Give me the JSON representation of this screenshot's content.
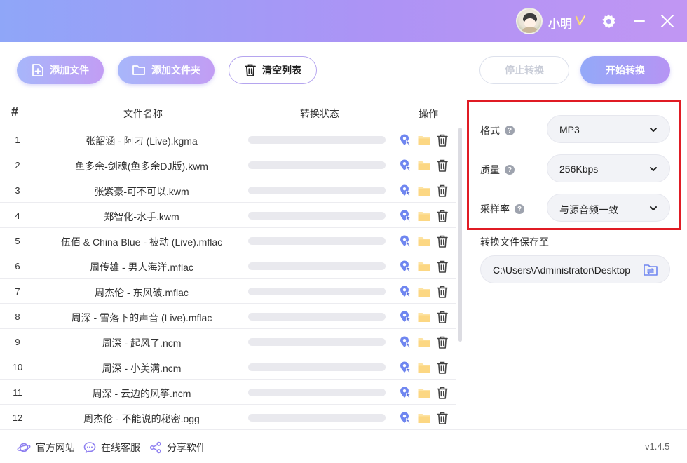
{
  "header": {
    "username": "小明",
    "vip_badge": "V",
    "icons": {
      "settings": "gear-icon",
      "minimize": "minimize-icon",
      "close": "close-icon"
    }
  },
  "toolbar": {
    "add_file": "添加文件",
    "add_folder": "添加文件夹",
    "clear_list": "清空列表",
    "stop_convert": "停止转换",
    "start_convert": "开始转换"
  },
  "table": {
    "columns": {
      "num": "#",
      "name": "文件名称",
      "status": "转换状态",
      "actions": "操作"
    },
    "rows": [
      {
        "num": "1",
        "name": "张韶涵 - 阿刁 (Live).kgma",
        "progress": 0
      },
      {
        "num": "2",
        "name": "鱼多余-剑魂(鱼多余DJ版).kwm",
        "progress": 0
      },
      {
        "num": "3",
        "name": "张紫豪-可不可以.kwm",
        "progress": 0
      },
      {
        "num": "4",
        "name": "郑智化-水手.kwm",
        "progress": 0
      },
      {
        "num": "5",
        "name": "伍佰 & China Blue - 被动 (Live).mflac",
        "progress": 0
      },
      {
        "num": "6",
        "name": "周传雄 - 男人海洋.mflac",
        "progress": 0
      },
      {
        "num": "7",
        "name": "周杰伦 - 东风破.mflac",
        "progress": 0
      },
      {
        "num": "8",
        "name": "周深 - 雪落下的声音 (Live).mflac",
        "progress": 0
      },
      {
        "num": "9",
        "name": "周深 - 起风了.ncm",
        "progress": 0
      },
      {
        "num": "10",
        "name": "周深 - 小美满.ncm",
        "progress": 0
      },
      {
        "num": "11",
        "name": "周深 - 云边的风筝.ncm",
        "progress": 0
      },
      {
        "num": "12",
        "name": "周杰伦 - 不能说的秘密.ogg",
        "progress": 0
      }
    ]
  },
  "settings": {
    "format": {
      "label": "格式",
      "value": "MP3"
    },
    "quality": {
      "label": "质量",
      "value": "256Kbps"
    },
    "sample_rate": {
      "label": "采样率",
      "value": "与源音频一致"
    },
    "save_to_label": "转换文件保存至",
    "save_path": "C:\\Users\\Administrator\\Desktop"
  },
  "footer": {
    "website": "官方网站",
    "support": "在线客服",
    "share": "分享软件",
    "version": "v1.4.5"
  },
  "colors": {
    "accent_start": "#93a9f8",
    "accent_end": "#b694f4",
    "highlight_frame": "#e01b24"
  }
}
